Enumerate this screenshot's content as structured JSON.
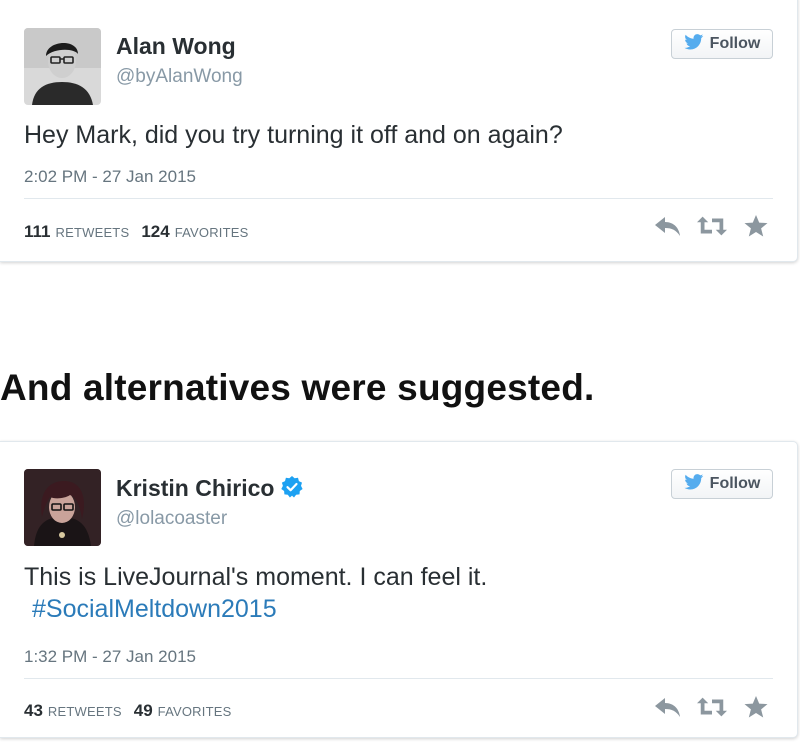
{
  "tweets": [
    {
      "display_name": "Alan Wong",
      "screen_name": "@byAlanWong",
      "verified": false,
      "follow_label": "Follow",
      "text": "Hey Mark, did you try turning it off and on again?",
      "hashtag": "",
      "timestamp": "2:02 PM - 27 Jan 2015",
      "retweets": "111",
      "retweets_label": "RETWEETS",
      "favorites": "124",
      "favorites_label": "FAVORITES"
    },
    {
      "display_name": "Kristin Chirico",
      "screen_name": "@lolacoaster",
      "verified": true,
      "follow_label": "Follow",
      "text": "This is LiveJournal's moment. I can feel it.",
      "hashtag": "#SocialMeltdown2015",
      "timestamp": "1:32 PM - 27 Jan 2015",
      "retweets": "43",
      "retweets_label": "RETWEETS",
      "favorites": "49",
      "favorites_label": "FAVORITES"
    }
  ],
  "heading": "And alternatives were suggested.",
  "icons": {
    "reply": "reply-icon",
    "retweet": "retweet-icon",
    "favorite": "star-icon",
    "bird": "twitter-bird-icon",
    "verified": "verified-badge-icon"
  },
  "colors": {
    "link": "#2b7bb9",
    "bird": "#55acee",
    "verified": "#1da1f2",
    "muted": "#8899a6",
    "action": "#8c979f"
  }
}
